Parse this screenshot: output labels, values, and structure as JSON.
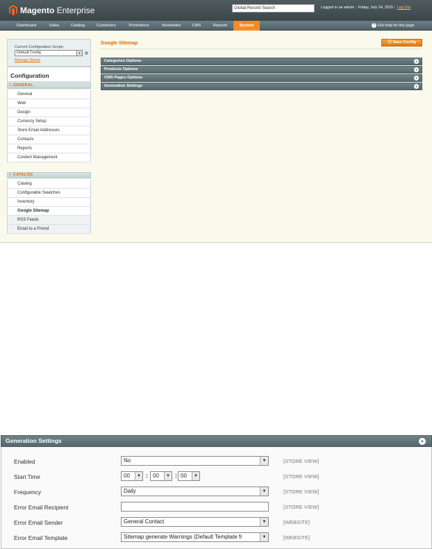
{
  "header": {
    "brand_main": "Magento",
    "brand_sub": "Enterprise",
    "global_search_value": "Global Record Search",
    "logged_in": "Logged in as admin",
    "date": "Friday, July 24, 2015",
    "logout": "Log Out"
  },
  "nav": {
    "items": [
      "Dashboard",
      "Sales",
      "Catalog",
      "Customers",
      "Promotions",
      "Newsletter",
      "CMS",
      "Reports",
      "System"
    ],
    "active": "System",
    "help": "Get help for this page"
  },
  "sidebar": {
    "scope_label": "Current Configuration Scope:",
    "scope_value": "Default Config",
    "manage_stores": "Manage Stores",
    "title": "Configuration",
    "general_head": "GENERAL",
    "general_items": [
      "General",
      "Web",
      "Design",
      "Currency Setup",
      "Store Email Addresses",
      "Contacts",
      "Reports",
      "Content Management"
    ],
    "catalog_head": "CATALOG",
    "catalog_items": [
      "Catalog",
      "Configurable Swatches",
      "Inventory",
      "Google Sitemap",
      "RSS Feeds",
      "Email to a Friend"
    ],
    "active_item": "Google Sitemap"
  },
  "main": {
    "title": "Google Sitemap",
    "save_button": "Save Config",
    "sections": [
      "Categories Options",
      "Products Options",
      "CMS Pages Options",
      "Generation Settings"
    ]
  },
  "generation": {
    "title": "Generation Settings",
    "enabled_label": "Enabled",
    "enabled_value": "No",
    "enabled_scope": "[STORE VIEW]",
    "start_time_label": "Start Time",
    "start_hour": "00",
    "start_minute": "00",
    "start_second": "00",
    "start_time_scope": "[STORE VIEW]",
    "frequency_label": "Frequency",
    "frequency_value": "Daily",
    "frequency_scope": "[STORE VIEW]",
    "recipient_label": "Error Email Recipient",
    "recipient_value": "",
    "recipient_scope": "[STORE VIEW]",
    "sender_label": "Error Email Sender",
    "sender_value": "General Contact",
    "sender_scope": "[WEBSITE]",
    "template_label": "Error Email Template",
    "template_value": "Sitemap generate Warnings (Default Template fr",
    "template_scope": "[WEBSITE]"
  },
  "colors": {
    "accent": "#e26703",
    "nav_active": "#f28c28",
    "header": "#3c4649"
  },
  "icons": {
    "dropdown": "chevron-down-icon",
    "section_toggle": "circle-arrow-icon",
    "help": "help-circle-icon"
  }
}
